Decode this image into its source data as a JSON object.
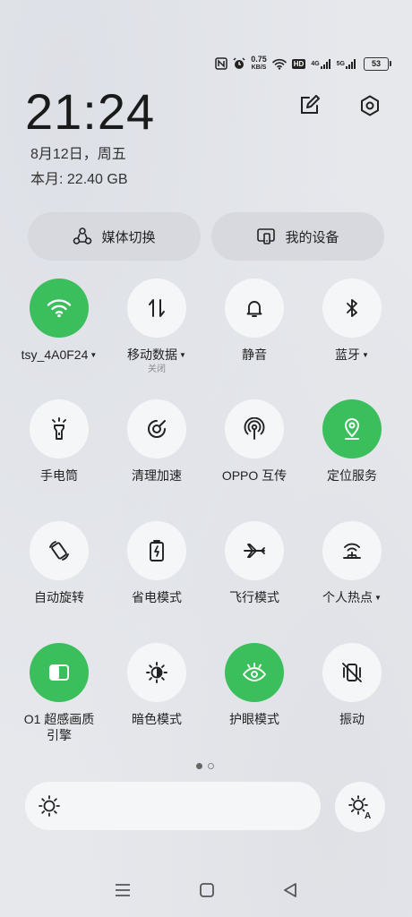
{
  "status_bar": {
    "speed_value": "0.75",
    "speed_unit": "KB/S",
    "hd_label": "HD",
    "net1": "4G",
    "net2": "5G",
    "battery": "53"
  },
  "header": {
    "time": "21:24",
    "date": "8月12日，周五",
    "data_usage": "本月: 22.40 GB"
  },
  "quick_buttons": {
    "media": "媒体切换",
    "devices": "我的设备"
  },
  "tiles": [
    {
      "label": "tsy_4A0F24",
      "sub": "",
      "on": true,
      "icon": "wifi-icon",
      "caret": true
    },
    {
      "label": "移动数据",
      "sub": "关闭",
      "on": false,
      "icon": "mobile-data-icon",
      "caret": true
    },
    {
      "label": "静音",
      "sub": "",
      "on": false,
      "icon": "bell-icon",
      "caret": false
    },
    {
      "label": "蓝牙",
      "sub": "",
      "on": false,
      "icon": "bluetooth-icon",
      "caret": true
    },
    {
      "label": "手电筒",
      "sub": "",
      "on": false,
      "icon": "flashlight-icon",
      "caret": false
    },
    {
      "label": "清理加速",
      "sub": "",
      "on": false,
      "icon": "clean-speed-icon",
      "caret": false
    },
    {
      "label": "OPPO 互传",
      "sub": "",
      "on": false,
      "icon": "share-antenna-icon",
      "caret": false
    },
    {
      "label": "定位服务",
      "sub": "",
      "on": true,
      "icon": "location-icon",
      "caret": false
    },
    {
      "label": "自动旋转",
      "sub": "",
      "on": false,
      "icon": "rotate-icon",
      "caret": false
    },
    {
      "label": "省电模式",
      "sub": "",
      "on": false,
      "icon": "battery-saver-icon",
      "caret": false
    },
    {
      "label": "飞行模式",
      "sub": "",
      "on": false,
      "icon": "airplane-icon",
      "caret": false
    },
    {
      "label": "个人热点",
      "sub": "",
      "on": false,
      "icon": "hotspot-icon",
      "caret": true
    },
    {
      "label": "O1 超感画质引擎",
      "sub": "",
      "on": true,
      "icon": "display-engine-icon",
      "caret": false
    },
    {
      "label": "暗色模式",
      "sub": "",
      "on": false,
      "icon": "dark-mode-icon",
      "caret": false
    },
    {
      "label": "护眼模式",
      "sub": "",
      "on": true,
      "icon": "eye-icon",
      "caret": false
    },
    {
      "label": "振动",
      "sub": "",
      "on": false,
      "icon": "vibrate-icon",
      "caret": false
    }
  ],
  "colors": {
    "accent_on": "#3bbf5c",
    "tile_off": "#f5f6f8"
  }
}
